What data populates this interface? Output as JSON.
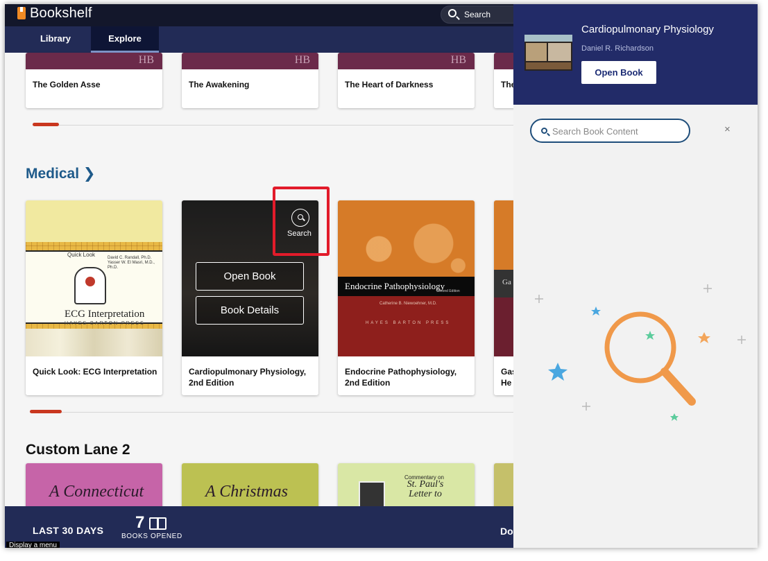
{
  "app": {
    "title": "Bookshelf",
    "search_label": "Search"
  },
  "tabs": [
    {
      "label": "Library"
    },
    {
      "label": "Explore"
    }
  ],
  "lanes": {
    "top": {
      "books": [
        {
          "title": "The Golden Asse",
          "mark": "HB"
        },
        {
          "title": "The Awakening",
          "mark": "HB"
        },
        {
          "title": "The Heart of Darkness",
          "mark": "HB"
        },
        {
          "title": "The"
        }
      ]
    },
    "medical": {
      "title": "Medical",
      "books": [
        {
          "title": "Quick Look: ECG Interpretation",
          "cover_lines": [
            "Quick Look",
            "David C. Randall, Ph.D.",
            "Yasser W. El Masri, M.D., Ph.D.",
            "ECG Interpretation",
            "HAYES BARTON PRESS"
          ]
        },
        {
          "title": "Cardiopulmonary Physiology, 2nd Edition"
        },
        {
          "title": "Endocrine Pathophysiology, 2nd Edition",
          "cover_lines": [
            "Endocrine Pathophysiology",
            "Second Edition",
            "Catherine B. Niewoehner, M.D.",
            "HAYES BARTON PRESS"
          ]
        },
        {
          "title": "Gas He",
          "cover_line": "Ga Pat"
        }
      ],
      "overlay": {
        "open_label": "Open Book",
        "details_label": "Book Details",
        "search_label": "Search"
      }
    },
    "custom": {
      "title": "Custom Lane 2",
      "covers": [
        "A Connecticut",
        "A Christmas",
        {
          "line1": "Commentary on",
          "line2": "St. Paul's Letter to"
        }
      ]
    }
  },
  "footer": {
    "period_label": "LAST 30 DAYS",
    "count": "7",
    "count_label": "BOOKS OPENED",
    "right_label": "Do"
  },
  "tooltip": "Display a menu",
  "panel": {
    "title": "Cardiopulmonary Physiology",
    "author": "Daniel R. Richardson",
    "open_label": "Open Book",
    "search_placeholder": "Search Book Content",
    "close_label": "×"
  },
  "colors": {
    "accent_red": "#c9371f",
    "nav_dark": "#222b56",
    "medical_blue": "#1e5a8a",
    "highlight_red": "#e21b2a",
    "panel_head": "#222b68"
  }
}
